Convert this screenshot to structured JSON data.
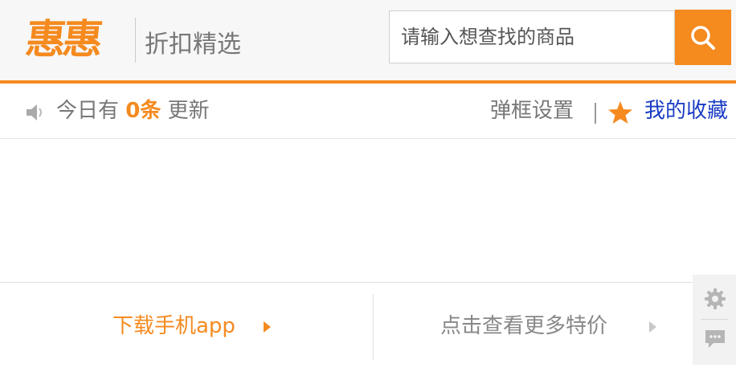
{
  "header": {
    "logo_text": "惠惠",
    "tagline": "折扣精选",
    "search": {
      "placeholder": "请输入想查找的商品",
      "value": "",
      "button_icon": "search-icon"
    }
  },
  "infobar": {
    "speaker_icon": "speaker-icon",
    "notice_prefix": "今日有",
    "notice_count": "0条",
    "notice_suffix": "更新",
    "popup_settings": "弹框设置",
    "favorites_icon": "star-icon",
    "favorites": "我的收藏"
  },
  "footer": {
    "download_app": "下载手机app",
    "more_deals": "点击查看更多特价"
  },
  "side_tools": [
    "gear-icon",
    "chat-icon"
  ],
  "colors": {
    "accent": "#f58a1f",
    "link_blue": "#1a3cc4",
    "text_gray": "#777777"
  }
}
